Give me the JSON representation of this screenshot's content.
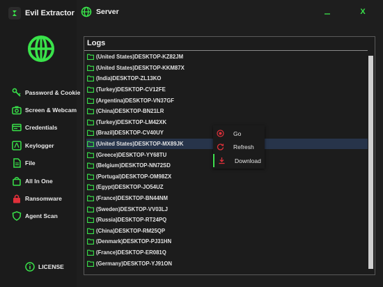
{
  "app": {
    "title": "Evil Extractor"
  },
  "header": {
    "title": "Server",
    "minimize_label": "_",
    "close_label": "X"
  },
  "sidebar": {
    "items": [
      {
        "label": "Password & Cookie",
        "icon": "key-icon"
      },
      {
        "label": "Screen & Webcam",
        "icon": "camera-icon"
      },
      {
        "label": "Credentials",
        "icon": "id-card-icon"
      },
      {
        "label": "Keylogger",
        "icon": "keyboard-icon"
      },
      {
        "label": "File",
        "icon": "file-icon"
      },
      {
        "label": "All In One",
        "icon": "bag-icon"
      },
      {
        "label": "Ransomware",
        "icon": "lock-icon"
      },
      {
        "label": "Agent Scan",
        "icon": "shield-icon"
      }
    ],
    "license_label": "LICENSE"
  },
  "logs": {
    "title": "Logs",
    "rows": [
      "(United States)DESKTOP-KZ82JM",
      "(United States)DESKTOP-KKM87X",
      "(India)DESKTOP-ZL13KO",
      "(Turkey)DESKTOP-CV12FE",
      "(Argentina)DESKTOP-VN37GF",
      "(China)DESKTOP-BN21LR",
      "(Turkey)DESKTOP-LM42XK",
      "(Brazil)DESKTOP-CV40UY",
      "(United States)DESKTOP-MX89JK",
      "(Greece)DESKTOP-YY68TU",
      "(Belgium)DESKTOP-NN72SD",
      "(Portugal)DESKTOP-OM98ZX",
      "(Egypt)DESKTOP-JO54UZ",
      "(France)DESKTOP-BN44NM",
      "(Sweden)DESKTOP-VV03LJ",
      "(Russia)DESKTOP-RT24PQ",
      "(China)DESKTOP-RM25QP",
      "(Denmark)DESKTOP-PJ31HN",
      "(France)DESKTOP-ER081Q",
      "(Germany)DESKTOP-YJ91ON"
    ],
    "selected_index": 8
  },
  "context_menu": {
    "items": [
      {
        "label": "Go",
        "icon": "record-icon"
      },
      {
        "label": "Refresh",
        "icon": "refresh-icon"
      },
      {
        "label": "Download",
        "icon": "download-icon"
      }
    ]
  },
  "colors": {
    "accent": "#39e34a",
    "danger": "#e0303a",
    "selection": "#27344a"
  }
}
